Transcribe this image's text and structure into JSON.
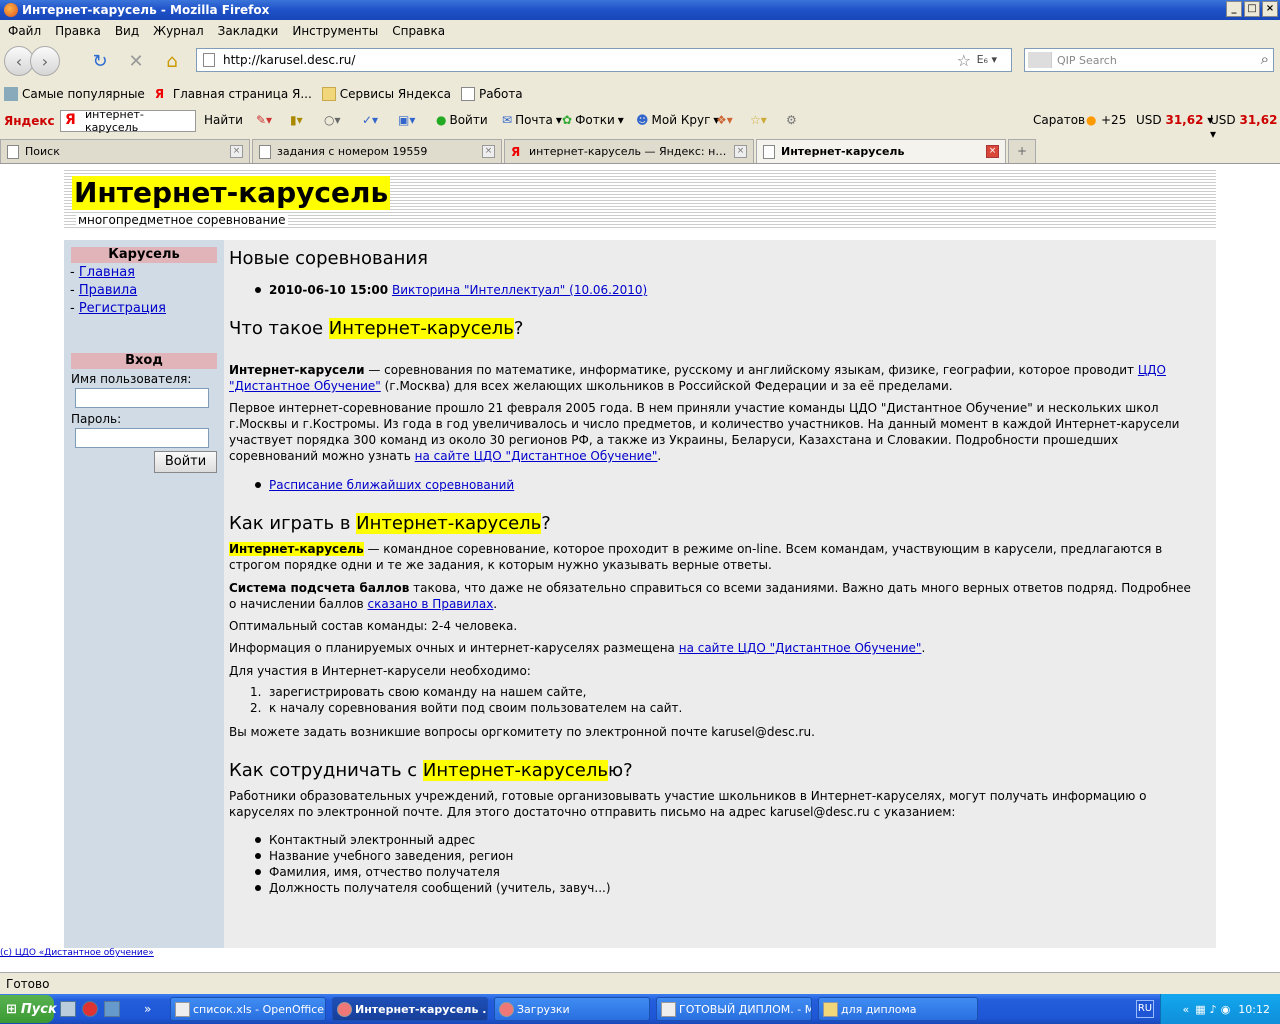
{
  "window": {
    "title": "Интернет-карусель - Mozilla Firefox"
  },
  "menu": [
    "Файл",
    "Правка",
    "Вид",
    "Журнал",
    "Закладки",
    "Инструменты",
    "Справка"
  ],
  "nav": {
    "url": "http://karusel.desc.ru/",
    "search_placeholder": "QIP Search"
  },
  "bookmarks": [
    "Самые популярные",
    "Главная страница Я...",
    "Сервисы Яндекса",
    "Работа"
  ],
  "yandex_bar": {
    "logo": "Яндекс",
    "query": "интернет-карусель",
    "find": "Найти",
    "login": "Войти",
    "mail": "Почта",
    "photos": "Фотки",
    "circle": "Мой Круг",
    "city": "Саратов",
    "temp": "+25",
    "usd1_label": "USD",
    "usd1_value": "31,62",
    "usd2_label": "USD",
    "usd2_value": "31,62"
  },
  "tabs": [
    {
      "label": "Поиск",
      "active": false
    },
    {
      "label": "задания с номером 19559",
      "active": false
    },
    {
      "label": "интернет-карусель — Яндекс: нашл...",
      "active": false
    },
    {
      "label": "Интернет-карусель",
      "active": true
    }
  ],
  "page": {
    "title": "Интернет-карусель",
    "subtitle": "многопредметное соревнование",
    "sidebar": {
      "menu_head": "Карусель",
      "links": [
        "Главная",
        "Правила",
        "Регистрация"
      ],
      "login_head": "Вход",
      "username_label": "Имя пользователя:",
      "password_label": "Пароль:",
      "login_button": "Войти"
    },
    "main": {
      "new_comp_heading": "Новые соревнования",
      "comp_date": "2010-06-10 15:00",
      "comp_link": "Викторина \"Интеллектуал\" (10.06.2010)",
      "what_heading_pre": "Что такое ",
      "what_heading_hl": "Интернет-карусель",
      "what_heading_post": "?",
      "p1_bold": "Интернет-карусели",
      "p1_text": " — соревнования по математике, информатике, русскому и английскому языкам, физике, географии, которое проводит ",
      "p1_link": "ЦДО \"Дистантное Обучение\"",
      "p1_tail": " (г.Москва) для всех желающих школьников в Российской Федерации и за её пределами.",
      "p2_text": "Первое интернет-соревнование прошло 21 февраля 2005 года. В нем приняли участие команды ЦДО \"Дистантное Обучение\" и нескольких школ г.Москвы и г.Костромы. Из года в год увеличивалось и число предметов, и количество участников. На данный момент в каждой Интернет-карусели участвует порядка 300 команд из около 30 регионов РФ, а также из Украины, Беларуси, Казахстана и Словакии. Подробности прошедших соревнований можно узнать ",
      "p2_link": "на сайте ЦДО \"Дистантное Обучение\"",
      "p2_tail": ".",
      "schedule_link": "Расписание ближайших соревнований",
      "how_heading_pre": "Как играть в ",
      "how_heading_hl": "Интернет-карусель",
      "how_heading_post": "?",
      "p3_bold": "Интернет-карусель",
      "p3_text": " — командное соревнование, которое проходит в режиме on-line. Всем командам, участвующим в карусели, предлагаются в строгом порядке одни и те же задания, к которым нужно указывать верные ответы.",
      "p4_bold": "Система подсчета баллов",
      "p4_text": " такова, что даже не обязательно справиться со всеми заданиями. Важно дать много верных ответов подряд. Подробнее о начислении баллов ",
      "p4_link": "сказано в Правилах",
      "p4_tail": ".",
      "p5": "Оптимальный состав команды: 2-4 человека.",
      "p6_text": "Информация о планируемых очных и интернет-каруселях размещена ",
      "p6_link": "на сайте ЦДО \"Дистантное Обучение\"",
      "p6_tail": ".",
      "p7": "Для участия в Интернет-карусели необходимо:",
      "steps": [
        "зарегистрировать свою команду на нашем сайте,",
        "к началу соревнования войти под своим пользователем на сайт."
      ],
      "p8": "Вы можете задать возникшие вопросы оргкомитету по электронной почте karusel@desc.ru.",
      "coop_heading_pre": "Как сотрудничать с ",
      "coop_heading_hl": "Интернет-карусель",
      "coop_heading_post": "ю?",
      "p9": "Работники образовательных учреждений, готовые организовывать участие школьников в Интернет-каруселях, могут получать информацию о каруселях по электронной почте. Для этого достаточно отправить письмо на адрес karusel@desc.ru с указанием:",
      "bullets": [
        "Контактный электронный адрес",
        "Название учебного заведения, регион",
        "Фамилия, имя, отчество получателя",
        "Должность получателя сообщений (учитель, завуч...)"
      ]
    },
    "footer": "(c) ЦДО «Дистантное обучение»"
  },
  "status": "Готово",
  "taskbar": {
    "start": "Пуск",
    "tasks": [
      "список.xls - OpenOffice....",
      "Интернет-карусель ...",
      "Загрузки",
      "ГОТОВЫЙ ДИПЛОМ. - M...",
      "для диплома"
    ],
    "lang": "RU",
    "clock": "10:12"
  }
}
